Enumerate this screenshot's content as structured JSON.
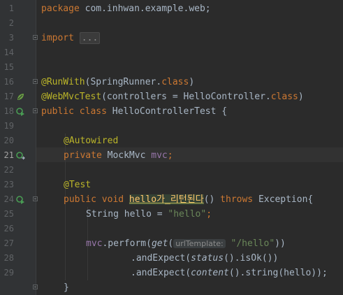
{
  "lines": {
    "l1": {
      "num": "1"
    },
    "l2": {
      "num": "2"
    },
    "l3": {
      "num": "3"
    },
    "l14": {
      "num": "14"
    },
    "l15": {
      "num": "15"
    },
    "l16": {
      "num": "16"
    },
    "l17": {
      "num": "17"
    },
    "l18": {
      "num": "18"
    },
    "l19": {
      "num": "19"
    },
    "l20": {
      "num": "20"
    },
    "l21": {
      "num": "21"
    },
    "l22": {
      "num": "22"
    },
    "l23": {
      "num": "23"
    },
    "l24": {
      "num": "24"
    },
    "l25": {
      "num": "25"
    },
    "l26": {
      "num": "26"
    },
    "l27": {
      "num": "27"
    },
    "l28": {
      "num": "28"
    },
    "l29": {
      "num": "29"
    }
  },
  "code": {
    "package_kw": "package",
    "package_name": " com.inhwan.example.web;",
    "import_kw": "import",
    "import_folded": "...",
    "runwith_ann": "@RunWith",
    "runwith_args_open": "(SpringRunner.",
    "runwith_class": "class",
    "runwith_close": ")",
    "webmvc_ann": "@WebMvcTest",
    "webmvc_open": "(controllers = HelloController.",
    "webmvc_class": "class",
    "webmvc_close": ")",
    "public_class_kw": "public class ",
    "class_name": "HelloControllerTest {",
    "autowired_ann": "@Autowired",
    "private_kw": "private ",
    "mockmvc_type": "MockMvc ",
    "mvc_field": "mvc",
    "semicolon": ";",
    "test_ann": "@Test",
    "public_void_kw": "public void ",
    "method_name": "hello가_리턴된다",
    "method_paren": "() ",
    "throws_kw": "throws",
    "exception": " Exception{",
    "string_decl": "String hello = ",
    "hello_literal": "\"hello\"",
    "mvc_ref": "mvc",
    "perform": ".perform(",
    "get_fn": "get",
    "get_open": "(",
    "url_hint": "urlTemplate:",
    "url_literal": "\"/hello\"",
    "perform_close": "))",
    "and_expect1": ".andExpect(",
    "status_fn": "status",
    "is_ok": "().isOk())",
    "and_expect2": ".andExpect(",
    "content_fn": "content",
    "string_hello": "().string(hello));",
    "close_brace": "}"
  },
  "icons": {
    "class_runner": "run-test-icon",
    "spring_bean": "spring-leaf-icon",
    "autowired": "autowired-navigate-icon",
    "method_runner": "run-test-icon"
  },
  "colors": {
    "background": "#2b2b2b",
    "keyword": "#cc7832",
    "annotation": "#bbb529",
    "string": "#6a8759",
    "field": "#9876aa",
    "method": "#ffc66d",
    "text": "#a9b7c6"
  }
}
